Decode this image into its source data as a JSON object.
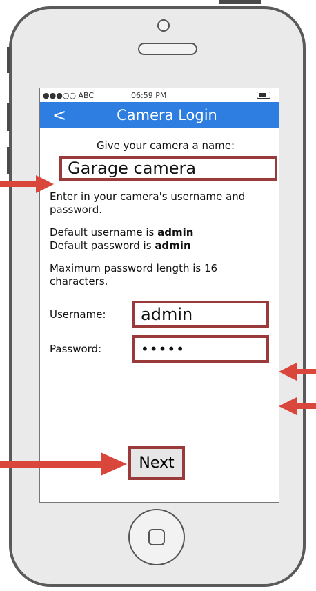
{
  "status_bar": {
    "carrier": "●●●○○ ABC",
    "time": "06:59 PM"
  },
  "nav": {
    "back": "<",
    "title": "Camera Login"
  },
  "form": {
    "name_prompt": "Give your camera a name:",
    "camera_name": "Garage camera",
    "instruction": "Enter in your camera's username and password.",
    "default_user_prefix": "Default username is ",
    "default_user": "admin",
    "default_pass_prefix": "Default password is ",
    "default_pass": "admin",
    "max_length_note": "Maximum password length is 16 characters.",
    "username_label": "Username:",
    "username_value": "admin",
    "password_label": "Password:",
    "password_value": "•••••",
    "next_label": "Next"
  },
  "colors": {
    "nav_blue": "#2e7de1",
    "highlight_red": "#9b3a3a",
    "arrow_red": "#d9473c"
  }
}
